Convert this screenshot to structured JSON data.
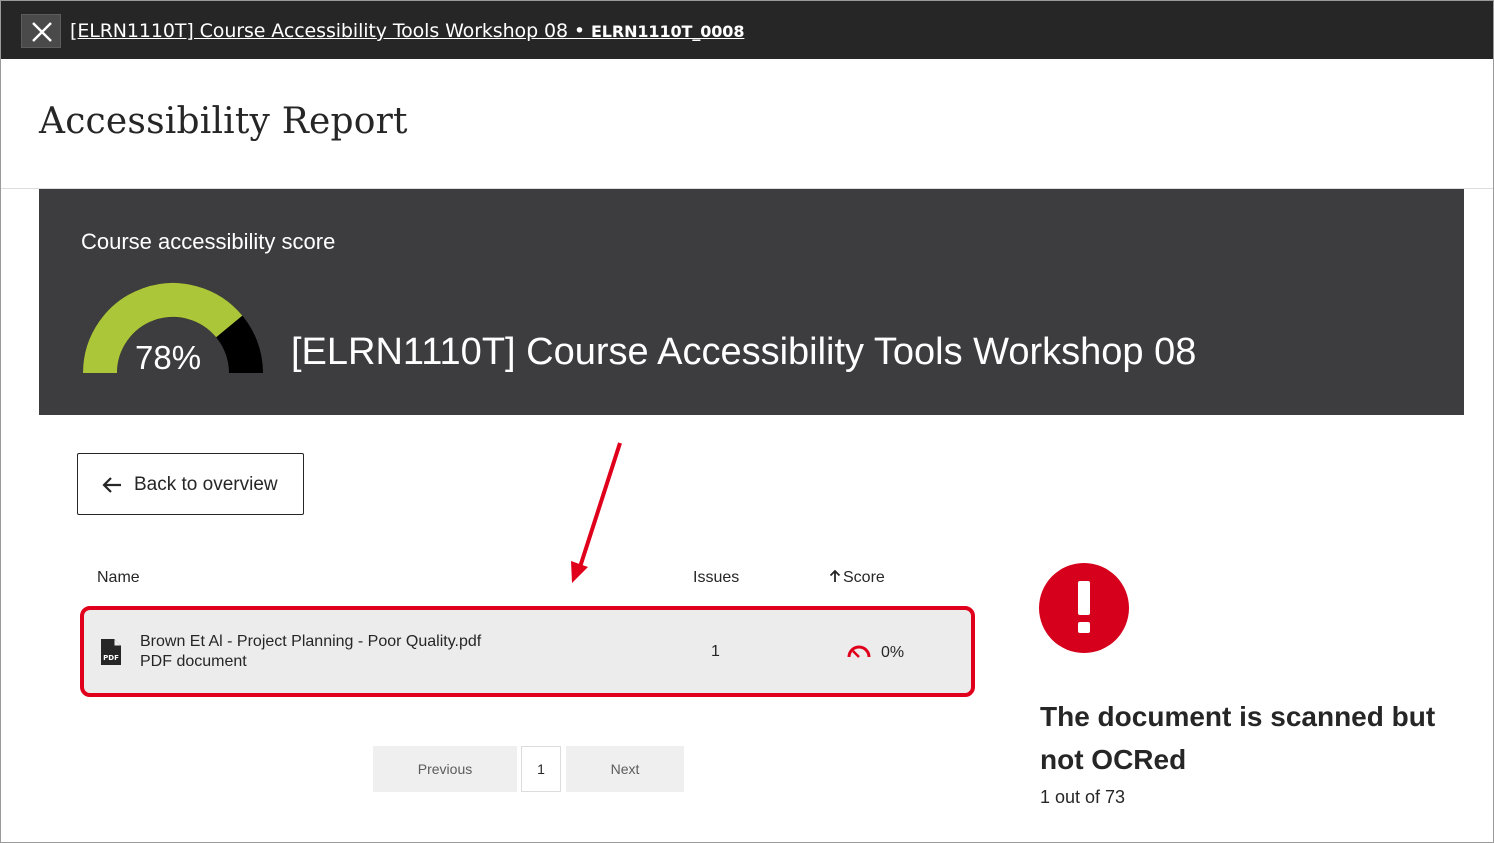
{
  "window": {
    "close_label": "Close",
    "breadcrumb_course": "[ELRN1110T] Course Accessibility Tools Workshop 08",
    "breadcrumb_separator": " • ",
    "breadcrumb_code": "ELRN1110T_0008"
  },
  "page": {
    "title": "Accessibility Report"
  },
  "score_banner": {
    "label": "Course accessibility score",
    "score_percent": 78,
    "score_text": "78%",
    "course_name": "[ELRN1110T] Course Accessibility Tools Workshop 08",
    "gauge_colors": {
      "filled": "#acc63a",
      "remaining": "#000000"
    }
  },
  "back_button": {
    "label": "Back to overview"
  },
  "table": {
    "columns": {
      "name": "Name",
      "issues": "Issues",
      "score": "Score"
    },
    "rows": [
      {
        "name": "Brown Et Al - Project Planning - Poor Quality.pdf",
        "type": "PDF document",
        "issues": "1",
        "score": "0%",
        "icon": "pdf-file-icon"
      }
    ]
  },
  "pagination": {
    "previous": "Previous",
    "current_page": "1",
    "next": "Next"
  },
  "issue_panel": {
    "title": "The document is scanned but not OCRed",
    "count": "1 out of 73",
    "icon_color": "#d6001c"
  },
  "colors": {
    "topbar": "#262626",
    "banner": "#3d3d40",
    "highlight": "#e0001b",
    "row_bg": "#ececec"
  }
}
